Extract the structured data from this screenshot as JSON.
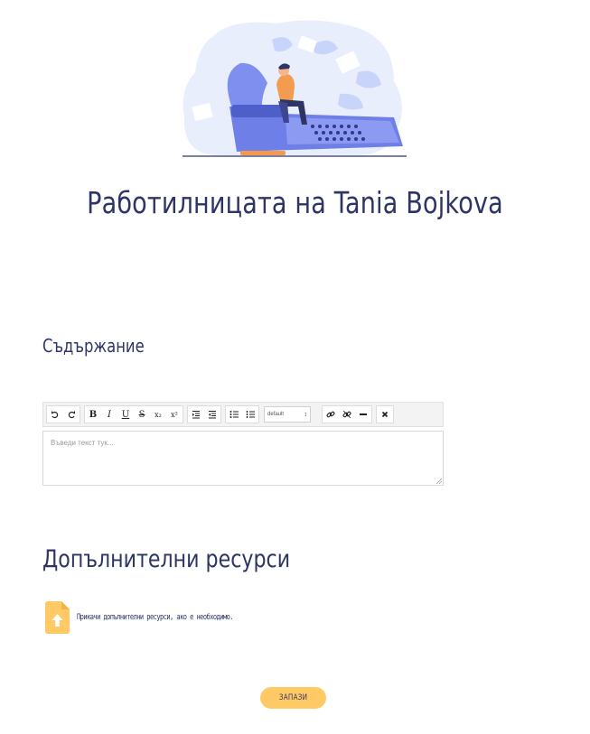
{
  "header": {
    "title": "Работилницата на Tania Bojkova",
    "illustration": "person-on-typewriter-illustration"
  },
  "content_section": {
    "title": "Съдържание",
    "editor": {
      "placeholder": "Въведи текст тук...",
      "toolbar": {
        "buttons": [
          "undo-icon",
          "redo-icon",
          "bold",
          "italic",
          "underline",
          "strikethrough",
          "subscript",
          "superscript",
          "indent-icon",
          "outdent-icon",
          "bullet-list-icon",
          "numbered-list-icon",
          "link-icon",
          "unlink-icon",
          "horizontal-rule-icon",
          "clear-format-icon"
        ],
        "bold_label": "B",
        "italic_label": "I",
        "underline_label": "U",
        "strike_label": "S",
        "subscript_label": "x₂",
        "superscript_label": "x²",
        "font_select": "default"
      }
    }
  },
  "resources_section": {
    "title": "Допълнителни ресурси",
    "attach_text": "Прикачи допълнителни ресурси, ако е необходимо."
  },
  "actions": {
    "save_label": "ЗАПАЗИ"
  },
  "colors": {
    "title_navy": "#2e3565",
    "accent_yellow": "#ffc965",
    "illustration_blue": "#6f7fe8",
    "illustration_light": "#e8eefc"
  }
}
